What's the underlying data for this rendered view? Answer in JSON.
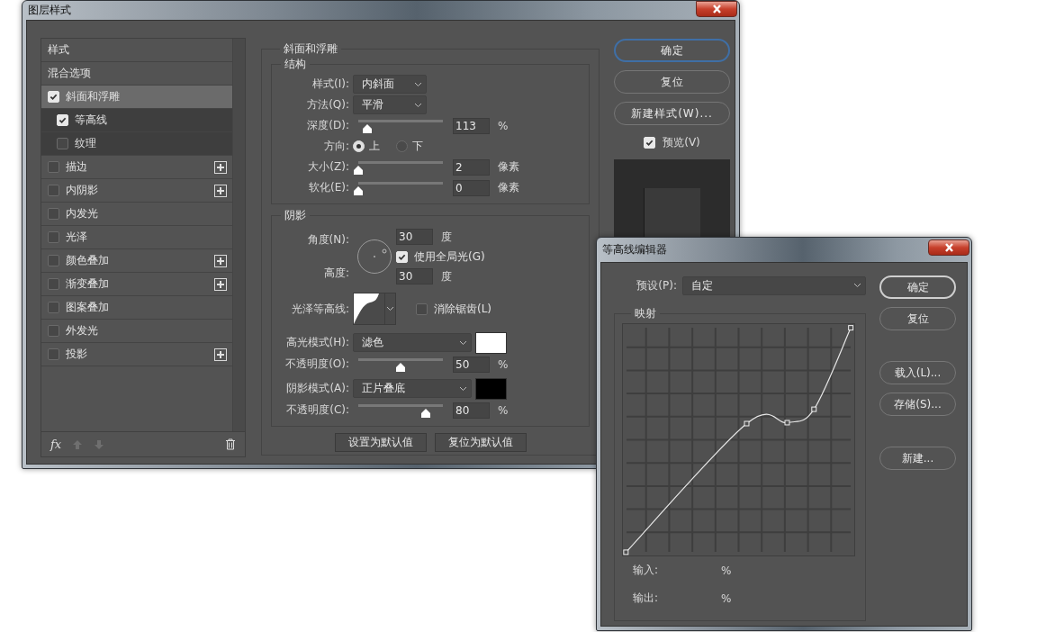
{
  "main_window": {
    "title": "图层样式"
  },
  "styles": {
    "items": [
      {
        "kind": "header",
        "label": "样式",
        "selected": false
      },
      {
        "kind": "header",
        "label": "混合选项",
        "selected": false
      },
      {
        "kind": "effect",
        "label": "斜面和浮雕",
        "checked": true,
        "selected": true,
        "addable": false,
        "children": [
          {
            "kind": "effect",
            "label": "等高线",
            "checked": true,
            "selected": false,
            "addable": false
          },
          {
            "kind": "effect",
            "label": "纹理",
            "checked": false,
            "selected": false,
            "addable": false
          }
        ]
      },
      {
        "kind": "effect",
        "label": "描边",
        "checked": false,
        "selected": false,
        "addable": true
      },
      {
        "kind": "effect",
        "label": "内阴影",
        "checked": false,
        "selected": false,
        "addable": true
      },
      {
        "kind": "effect",
        "label": "内发光",
        "checked": false,
        "selected": false,
        "addable": false
      },
      {
        "kind": "effect",
        "label": "光泽",
        "checked": false,
        "selected": false,
        "addable": false
      },
      {
        "kind": "effect",
        "label": "颜色叠加",
        "checked": false,
        "selected": false,
        "addable": true
      },
      {
        "kind": "effect",
        "label": "渐变叠加",
        "checked": false,
        "selected": false,
        "addable": true
      },
      {
        "kind": "effect",
        "label": "图案叠加",
        "checked": false,
        "selected": false,
        "addable": false
      },
      {
        "kind": "effect",
        "label": "外发光",
        "checked": false,
        "selected": false,
        "addable": false
      },
      {
        "kind": "effect",
        "label": "投影",
        "checked": false,
        "selected": false,
        "addable": true
      }
    ],
    "footer_label": "fx"
  },
  "bevel": {
    "title": "斜面和浮雕",
    "structure": {
      "title": "结构",
      "rows": [
        {
          "kind": "select",
          "label": "样式(I):",
          "value": "内斜面"
        },
        {
          "kind": "select",
          "label": "方法(Q):",
          "value": "平滑"
        },
        {
          "kind": "slider",
          "label": "深度(D):",
          "level": 0.11,
          "value": "113",
          "unit": "%"
        },
        {
          "kind": "radio",
          "label": "方向:",
          "options": [
            {
              "label": "上",
              "selected": true
            },
            {
              "label": "下",
              "selected": false
            }
          ]
        },
        {
          "kind": "slider",
          "label": "大小(Z):",
          "level": 0.0,
          "value": "2",
          "unit": "像素"
        },
        {
          "kind": "slider",
          "label": "软化(E):",
          "level": 0.0,
          "value": "0",
          "unit": "像素"
        }
      ]
    },
    "shading": {
      "title": "阴影",
      "angle": {
        "label": "角度(N):",
        "value": "30",
        "unit": "度"
      },
      "global_light": {
        "label": "使用全局光(G)",
        "checked": true
      },
      "altitude": {
        "label": "高度:",
        "value": "30",
        "unit": "度"
      },
      "rows": [
        {
          "kind": "contour",
          "label": "光泽等高线:",
          "option": {
            "label": "消除锯齿(L)",
            "checked": false
          }
        },
        {
          "kind": "select",
          "label": "高光模式(H):",
          "value": "滤色",
          "color": "#ffffff"
        },
        {
          "kind": "slider",
          "label": "不透明度(O):",
          "level": 0.5,
          "value": "50",
          "unit": "%"
        },
        {
          "kind": "select",
          "label": "阴影模式(A):",
          "value": "正片叠底",
          "color": "#000000"
        },
        {
          "kind": "slider",
          "label": "不透明度(C):",
          "level": 0.8,
          "value": "80",
          "unit": "%"
        }
      ]
    },
    "buttons": [
      "设置为默认值",
      "复位为默认值"
    ]
  },
  "actions": {
    "buttons": [
      {
        "label": "确定",
        "default": true
      },
      {
        "label": "复位",
        "default": false
      },
      {
        "label": "新建样式(W)...",
        "default": false
      }
    ],
    "preview": {
      "label": "预览(V)",
      "checked": true
    }
  },
  "contour_editor": {
    "title": "等高线编辑器",
    "preset": {
      "label": "预设(P):",
      "value": "自定"
    },
    "mapping": {
      "title": "映射",
      "readouts": [
        {
          "label": "输入:",
          "unit": "%"
        },
        {
          "label": "输出:",
          "unit": "%"
        }
      ]
    },
    "button_groups": [
      {
        "buttons": [
          {
            "label": "确定",
            "default": true
          },
          {
            "label": "复位",
            "default": false
          }
        ]
      },
      {
        "buttons": [
          {
            "label": "载入(L)...",
            "default": false
          },
          {
            "label": "存储(S)...",
            "default": false
          }
        ]
      },
      {
        "buttons": [
          {
            "label": "新建...",
            "default": false
          }
        ]
      }
    ]
  }
}
